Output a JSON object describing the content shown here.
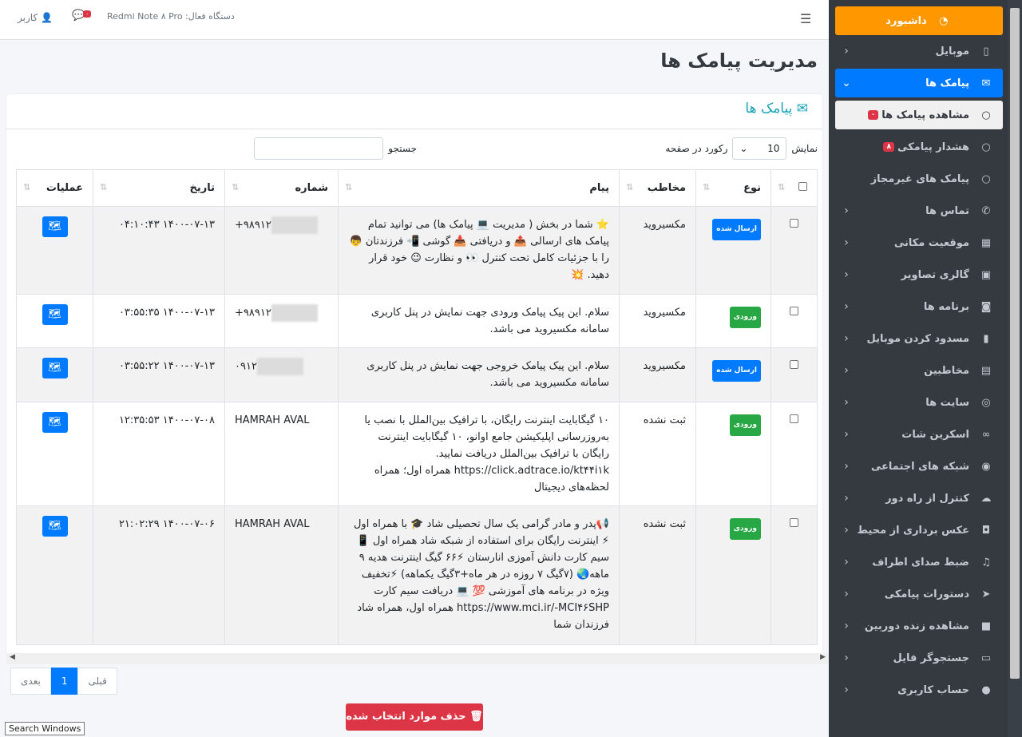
{
  "topbar": {
    "user_label": "کاربر",
    "device_label": "دستگاه فعال: Redmi Note ۸ Pro",
    "chat_badge": "۰"
  },
  "page_title": "مدیریت پیامک ها",
  "card_title": "پیامک ها",
  "controls": {
    "show_label": "نمایش",
    "per_page_value": "10",
    "per_page_suffix": "رکورد در صفحه",
    "search_label": "جستجو",
    "search_value": ""
  },
  "table": {
    "headers": [
      "نوع",
      "مخاطب",
      "پیام",
      "شماره",
      "تاریخ",
      "عملیات"
    ],
    "rows": [
      {
        "type": "ارسال شده",
        "type_kind": "out",
        "contact": "مکسیروید",
        "message": "⭐ شما در بخش ( مدیریت 💻 پیامک ها) می توانید تمام پیامک های ارسالی 📤 و دریافتی 📥 گوشی 📲 فرزندتان 👦 را با جزئیات کامل تحت کنترل 👀 و نظارت 😉 خود قرار دهید. 💥",
        "number": "+۹۸۹۱۲",
        "date": "۱۴۰۰-۰۷-۱۳ ۰۴:۱۰:۴۳"
      },
      {
        "type": "ورودی",
        "type_kind": "in",
        "contact": "مکسیروید",
        "message": "سلام. این پیک پیامک ورودی جهت نمایش در پنل کاربری سامانه مکسیروید می باشد.",
        "number": "+۹۸۹۱۲",
        "date": "۱۴۰۰-۰۷-۱۳ ۰۳:۵۵:۳۵"
      },
      {
        "type": "ارسال شده",
        "type_kind": "out",
        "contact": "مکسیروید",
        "message": "سلام. این پیک پیامک خروجی جهت نمایش در پنل کاربری سامانه مکسیروید می باشد.",
        "number": "۰۹۱۲",
        "date": "۱۴۰۰-۰۷-۱۳ ۰۳:۵۵:۲۲"
      },
      {
        "type": "ورودی",
        "type_kind": "in",
        "contact": "ثبت نشده",
        "message": "۱۰ گیگابایت اینترنت رایگان، با ترافیک بین‌الملل با نصب یا به‌روزرسانی اپلیکیشن جامع اوانو، ۱۰ گیگابایت اینترنت رایگان با ترافیک بین‌الملل دریافت نمایید. https://click.adtrace.io/kt۴۴i۱k همراه اول؛ همراه لحظه‌های دیجیتال",
        "number": "HAMRAH AVAL",
        "date": "۱۴۰۰-۰۷-۰۸ ۱۲:۳۵:۵۳"
      },
      {
        "type": "ورودی",
        "type_kind": "in",
        "contact": "ثبت نشده",
        "message": "📢پدر و مادر گرامی یک سال تحصیلی شاد 🎓 با همراه اول ⚡ اینترنت رایگان برای استفاده از شبکه شاد همراه اول 📱 سیم کارت دانش آموزی انارستان ⚡۶۶ گیگ اینترنت هدیه ۹ ماهه🌏 (۷گیگ ۷ روزه در هر ماه+۳گیگ یکماهه) ⚡تخفیف ویژه در برنامه های آموزشی 💯 💻 دریافت سیم کارت https://www.mci.ir/-MCI۴۶SHP همراه اول، همراه شاد فرزندان شما",
        "number": "HAMRAH AVAL",
        "date": "۱۴۰۰-۰۷-۰۶ ۲۱:۰۲:۲۹"
      }
    ]
  },
  "pagination": {
    "prev": "قبلی",
    "current": "1",
    "next": "بعدی"
  },
  "delete_button": "حذف موارد انتخاب شده",
  "tooltip": "Search Windows",
  "sidebar": {
    "items": [
      {
        "label": "داشبورد",
        "icon": "dashboard-icon"
      },
      {
        "label": "موبایل",
        "icon": "mobile-icon"
      },
      {
        "label": "پیامک ها",
        "icon": "envelope-icon"
      },
      {
        "label": "مشاهده پیامک ها",
        "icon": "circle-icon",
        "badge": "۰"
      },
      {
        "label": "هشدار پیامکی",
        "icon": "circle-icon",
        "badge": "۸"
      },
      {
        "label": "پیامک های غیرمجاز",
        "icon": "circle-icon"
      },
      {
        "label": "تماس ها",
        "icon": "phone-icon"
      },
      {
        "label": "موقعیت مکانی",
        "icon": "map-icon"
      },
      {
        "label": "گالری تصاویر",
        "icon": "image-icon"
      },
      {
        "label": "برنامه ها",
        "icon": "gamepad-icon"
      },
      {
        "label": "مسدود کردن موبایل",
        "icon": "lock-icon"
      },
      {
        "label": "مخاطبین",
        "icon": "book-icon"
      },
      {
        "label": "سایت ها",
        "icon": "chrome-icon"
      },
      {
        "label": "اسکرین شات",
        "icon": "binoculars-icon"
      },
      {
        "label": "شبکه های اجتماعی",
        "icon": "eye-icon"
      },
      {
        "label": "کنترل از راه دور",
        "icon": "cloud-icon"
      },
      {
        "label": "عکس برداری از محیط",
        "icon": "camera-icon"
      },
      {
        "label": "ضبط صدای اطراف",
        "icon": "audio-file-icon"
      },
      {
        "label": "دستورات پیامکی",
        "icon": "paper-plane-icon"
      },
      {
        "label": "مشاهده زنده دوربین",
        "icon": "video-icon"
      },
      {
        "label": "جستجوگر فایل",
        "icon": "folder-icon"
      },
      {
        "label": "حساب کاربری",
        "icon": "user-icon"
      }
    ]
  }
}
